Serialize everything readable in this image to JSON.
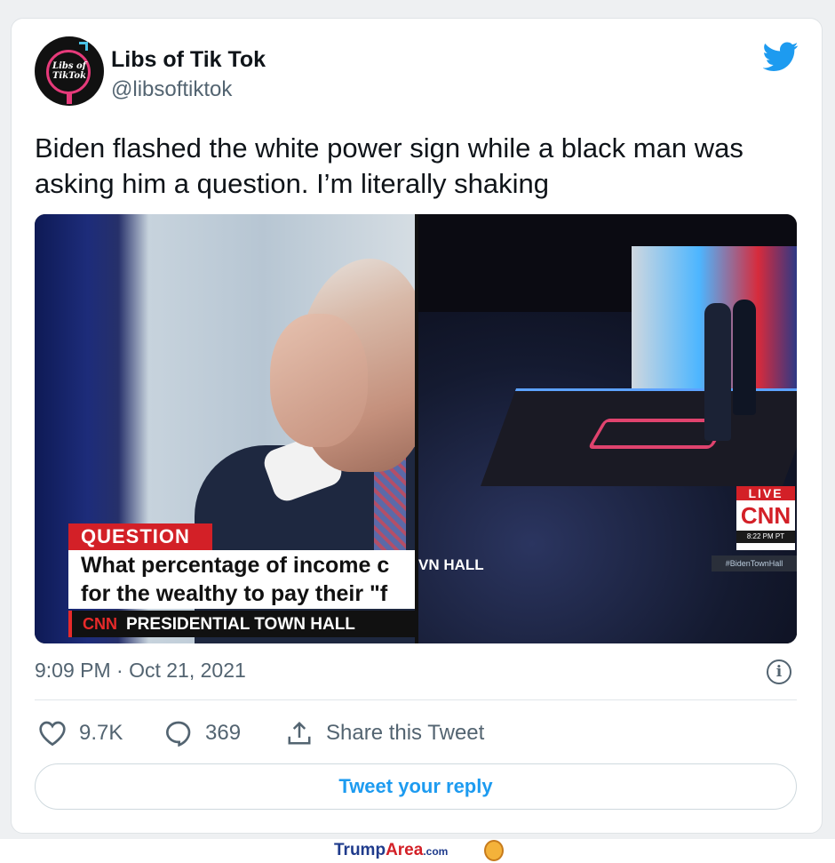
{
  "tweet": {
    "display_name": "Libs of Tik Tok",
    "handle": "@libsoftiktok",
    "avatar_text": "Libs of TikTok",
    "text_line1": "Biden flashed the white power sign while a black man was",
    "text_line2": "asking him a question. I’m literally shaking",
    "timestamp": "9:09 PM · Oct 21, 2021",
    "info_label": "i"
  },
  "media": {
    "left": {
      "question_tag": "QUESTION",
      "question_line1": "What percentage of income c",
      "question_line2": "for the wealthy to pay their \"f",
      "network": "CNN",
      "program": "PRESIDENTIAL TOWN HALL"
    },
    "right": {
      "live_label": "LIVE",
      "network": "CNN",
      "time": "8:22 PM PT",
      "hall_fragment": "VN HALL",
      "hashtag": "#BidenTownHall"
    }
  },
  "actions": {
    "likes": "9.7K",
    "replies": "369",
    "share_label": "Share this Tweet"
  },
  "reply_button": "Tweet your reply",
  "footer": {
    "brand_part1": "Trump",
    "brand_part2": "Area",
    "brand_part3": ".com"
  },
  "colors": {
    "twitter_blue": "#1d9bf0",
    "cnn_red": "#d32027",
    "text_dark": "#0f1419",
    "text_gray": "#536471"
  },
  "icons": {
    "brand": "twitter-bird-icon",
    "like": "heart-icon",
    "reply": "comment-icon",
    "share": "share-icon",
    "info": "info-icon"
  }
}
